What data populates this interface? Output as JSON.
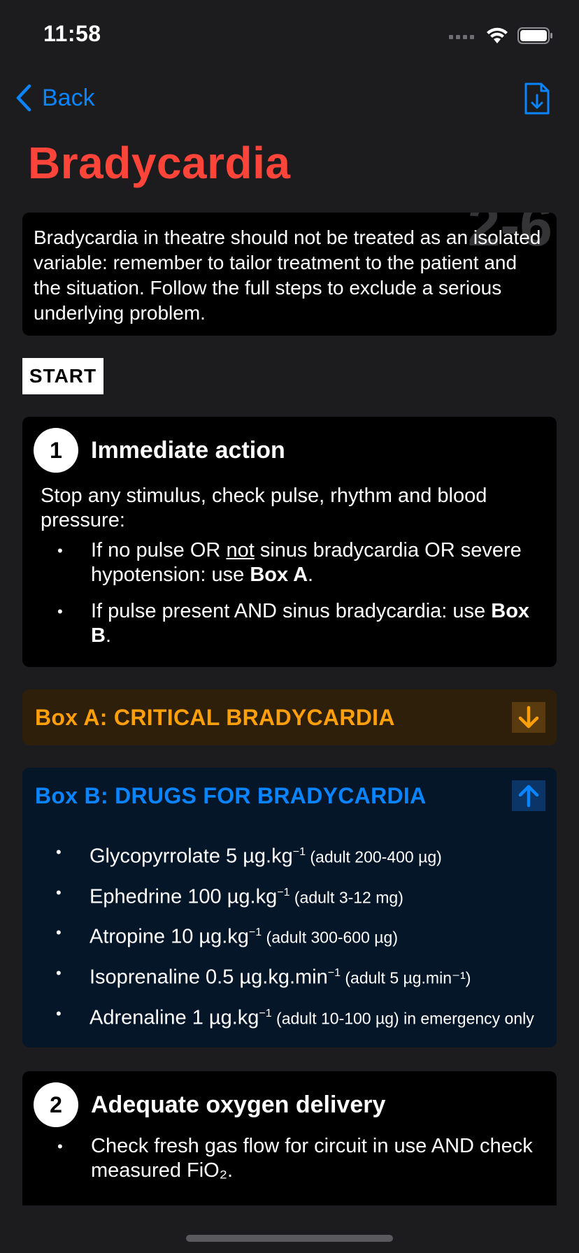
{
  "status": {
    "time": "11:58"
  },
  "nav": {
    "back_label": "Back"
  },
  "title": "Bradycardia",
  "intro": {
    "text": "Bradycardia in theatre should not be treated as an isolated variable: remember to tailor treatment to the patient and the situation. Follow the full steps to exclude a serious underlying problem.",
    "watermark": "2-6"
  },
  "start_label": "START",
  "step1": {
    "number": "1",
    "title": "Immediate action",
    "lead": "Stop any stimulus, check pulse, rhythm and blood pressure:",
    "bullet1_pre": "If no pulse OR ",
    "bullet1_under": "not",
    "bullet1_mid": " sinus bradycardia OR severe hypotension: use ",
    "bullet1_bold": "Box A",
    "bullet1_end": ".",
    "bullet2_pre": "If pulse present AND sinus bradycardia: use ",
    "bullet2_bold": "Box B",
    "bullet2_end": "."
  },
  "box_a": {
    "label": "Box A: CRITICAL BRADYCARDIA"
  },
  "box_b": {
    "label": "Box B: DRUGS FOR BRADYCARDIA",
    "drugs": [
      {
        "main": "Glycopyrrolate 5 µg.kg",
        "sup": "−1",
        "note": " (adult 200-400 µg)"
      },
      {
        "main": "Ephedrine 100 µg.kg",
        "sup": "−1",
        "note": " (adult 3-12 mg)"
      },
      {
        "main": "Atropine 10 µg.kg",
        "sup": "−1",
        "note": " (adult 300-600 µg)"
      },
      {
        "main": "Isoprenaline 0.5 µg.kg.min",
        "sup": "−1",
        "note": " (adult 5 µg.min⁻¹)"
      },
      {
        "main": "Adrenaline 1 µg.kg",
        "sup": "−1",
        "note": " (adult 10-100 µg) in emergency only"
      }
    ]
  },
  "step2": {
    "number": "2",
    "title": "Adequate oxygen delivery",
    "bullet1": "Check fresh gas flow for circuit in use AND check measured FiO₂."
  },
  "colors": {
    "accent_blue": "#0a84ff",
    "title_red": "#ff453a",
    "box_a_orange": "#ff9f0a",
    "background": "#1c1c1e"
  },
  "icons": {
    "back": "chevron-left-icon",
    "download": "document-download-icon",
    "box_a_toggle": "arrow-down-icon",
    "box_b_toggle": "arrow-up-icon"
  }
}
